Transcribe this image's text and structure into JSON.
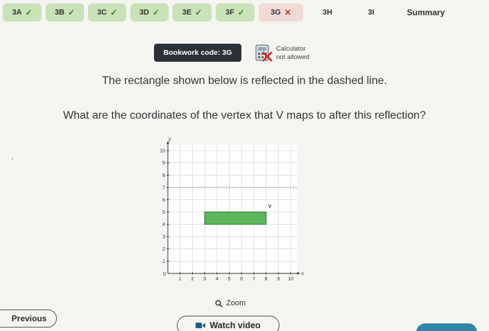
{
  "tabs": [
    {
      "label": "3A",
      "status": "correct",
      "mark": "✓"
    },
    {
      "label": "3B",
      "status": "correct",
      "mark": "✓"
    },
    {
      "label": "3C",
      "status": "correct",
      "mark": "✓"
    },
    {
      "label": "3D",
      "status": "correct",
      "mark": "✓"
    },
    {
      "label": "3E",
      "status": "correct",
      "mark": "✓"
    },
    {
      "label": "3F",
      "status": "correct",
      "mark": "✓"
    },
    {
      "label": "3G",
      "status": "incorrect",
      "mark": "✕"
    },
    {
      "label": "3H",
      "status": "unanswered",
      "mark": ""
    },
    {
      "label": "3I",
      "status": "unanswered",
      "mark": ""
    },
    {
      "label": "Summary",
      "status": "summary",
      "mark": ""
    }
  ],
  "bookwork": {
    "label": "Bookwork code: 3G"
  },
  "calculator": {
    "line1": "Calculator",
    "line2": "not allowed",
    "icon": "calculator-not-allowed-icon"
  },
  "question": {
    "line1": "The rectangle shown below is reflected in the dashed line.",
    "line2": "What are the coordinates of the vertex that V maps to after this reflection?"
  },
  "graph": {
    "axis_x": "x",
    "axis_y": "y",
    "origin": "0",
    "x_ticks": [
      "1",
      "2",
      "3",
      "4",
      "5",
      "6",
      "7",
      "8",
      "9",
      "10"
    ],
    "y_ticks": [
      "1",
      "2",
      "3",
      "4",
      "5",
      "6",
      "7",
      "8",
      "9",
      "10"
    ],
    "x_range": [
      0,
      10
    ],
    "y_range": [
      0,
      10
    ],
    "rectangle": {
      "x1": 3,
      "x2": 8,
      "y1": 4,
      "y2": 5,
      "fill": "#5cb85c"
    },
    "vertex_label": "V",
    "vertex": {
      "x": 8,
      "y": 5
    },
    "dashed_line_y": 7
  },
  "zoom": {
    "label": "Zoom",
    "icon": "magnifier-icon"
  },
  "buttons": {
    "previous": "Previous",
    "watch_video": "Watch video"
  },
  "colors": {
    "correct_tab": "#c9e2b8",
    "incorrect_tab": "#f0d9d6",
    "bookwork_bg": "#2b3036",
    "answer_button": "#2f86a8"
  }
}
